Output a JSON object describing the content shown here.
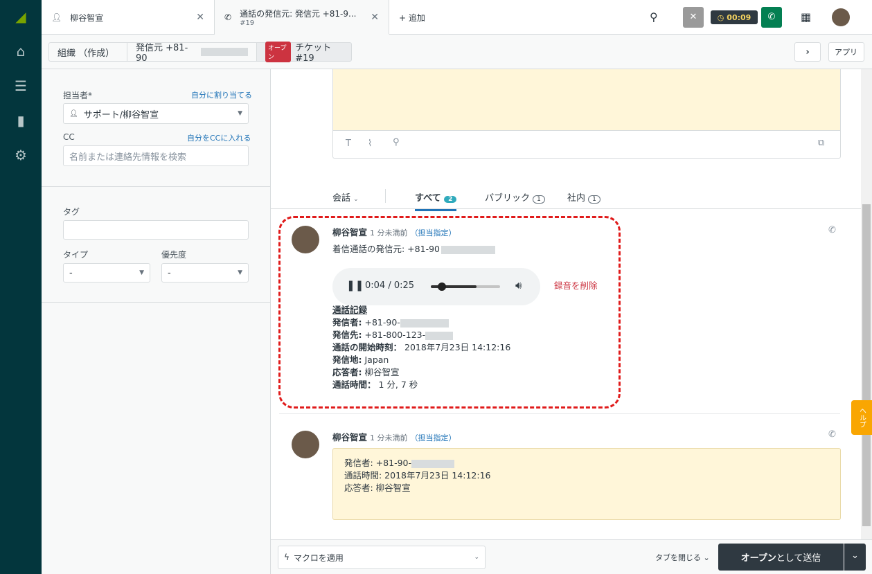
{
  "nav": {
    "icons": [
      "zendesk-logo",
      "home-icon",
      "views-icon",
      "reporting-icon",
      "admin-gear-icon"
    ]
  },
  "tabs": [
    {
      "label": "柳谷智宣"
    },
    {
      "label": "通話の発信元: 発信元 +81-9...",
      "sub": "#19"
    }
  ],
  "add_tab": "+ 追加",
  "timer": "00:09",
  "breadcrumbs": {
    "org": "組織 （作成）",
    "requester": "発信元 +81-90",
    "status_badge": "オープン",
    "ticket": "チケット #19"
  },
  "apps_label": "アプリ",
  "left": {
    "assignee_label": "担当者*",
    "assign_self": "自分に割り当てる",
    "assignee_value": "サポート/柳谷智宣",
    "cc_label": "CC",
    "cc_self": "自分をCCに入れる",
    "cc_placeholder": "名前または連絡先情報を検索",
    "tags_label": "タグ",
    "type_label": "タイプ",
    "type_value": "-",
    "priority_label": "優先度",
    "priority_value": "-"
  },
  "filter": {
    "conversations": "会話",
    "all": "すべて",
    "all_count": "2",
    "public": "パブリック",
    "public_count": "1",
    "internal": "社内",
    "internal_count": "1"
  },
  "event1": {
    "author": "柳谷智宣",
    "time": "1 分未満前",
    "assign": "（担当指定）",
    "title": "着信通話の発信元: +81-90",
    "player_time": "0:04 / 0:25",
    "player_progress": 0.16,
    "delete_recording": "録音を削除",
    "record_title": "通話記録",
    "rows": [
      {
        "k": "発信者:",
        "v": "+81-90-"
      },
      {
        "k": "発信先:",
        "v": "+81-800-123-"
      },
      {
        "k": "通話の開始時刻：",
        "v": "2018年7月23日 14:12:16"
      },
      {
        "k": "発信地:",
        "v": "Japan"
      },
      {
        "k": "応答者:",
        "v": "柳谷智宣"
      },
      {
        "k": "通話時間：",
        "v": "1 分, 7 秒"
      }
    ]
  },
  "event2": {
    "author": "柳谷智宣",
    "time": "1 分未満前",
    "assign": "（担当指定）",
    "lines": [
      "発信者: +81-90-",
      "通話時間: 2018年7月23日 14:12:16",
      "応答者: 柳谷智宣"
    ]
  },
  "bottom": {
    "macro": "マクロを適用",
    "close_tab": "タブを閉じる",
    "submit_status": "オープン",
    "submit_rest": "として送信"
  },
  "help": "ヘルプ",
  "colors": {
    "nav": "#03363d",
    "accent": "#1f73b7",
    "open": "#cc3340",
    "call": "#037f52",
    "note": "#fff6d9"
  }
}
